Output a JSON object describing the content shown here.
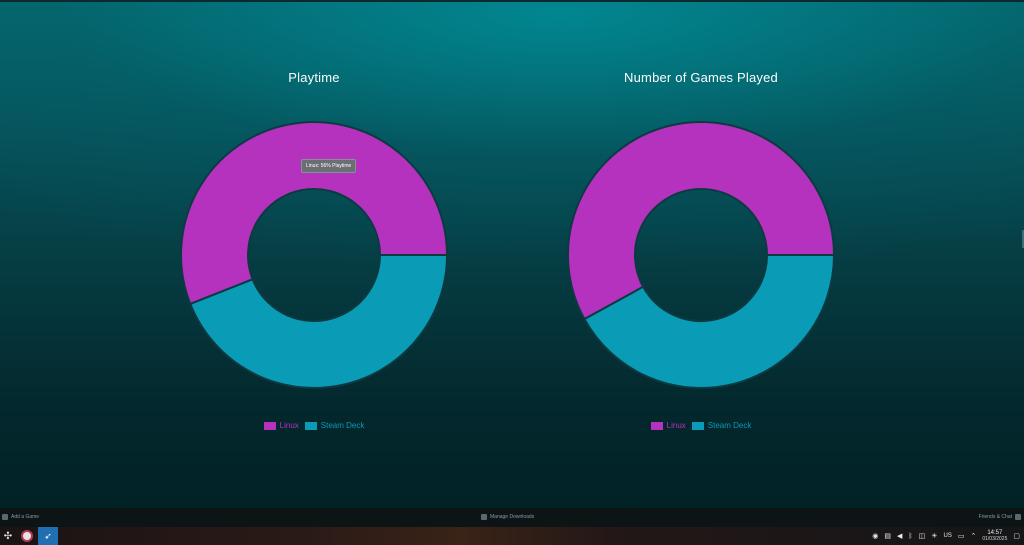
{
  "tooltip": {
    "text": "Linux: 56% Playtime"
  },
  "chart_data": [
    {
      "type": "pie",
      "title": "Playtime",
      "categories": [
        "Linux",
        "Steam Deck"
      ],
      "values": [
        56,
        44
      ],
      "colors": [
        "#b532be",
        "#0a9bb6"
      ],
      "legend": "bottom"
    },
    {
      "type": "pie",
      "title": "Number of Games Played",
      "categories": [
        "Linux",
        "Steam Deck"
      ],
      "values": [
        58,
        42
      ],
      "colors": [
        "#b532be",
        "#0a9bb6"
      ],
      "legend": "bottom"
    }
  ],
  "footer": {
    "add_game": "Add a Game",
    "manage_downloads": "Manage Downloads",
    "friends_chat": "Friends & Chat"
  },
  "taskbar": {
    "start_icon": "plasma-launcher-icon",
    "apps": [
      "vivaldi-icon",
      "steam-icon"
    ],
    "tray_icons": [
      "steam-icon",
      "clipboard-icon",
      "volume-icon",
      "bluetooth-icon",
      "network-icon",
      "brightness-icon",
      "keyboard-layout-icon",
      "display-icon",
      "expand-tray-icon",
      "desktop-icon"
    ],
    "keyboard_layout": "US",
    "time": "14:57",
    "date": "01/03/2025"
  }
}
